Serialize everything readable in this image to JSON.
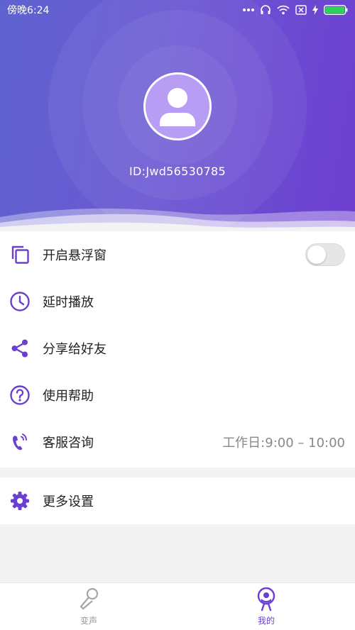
{
  "status_bar": {
    "time": "傍晚6:24"
  },
  "profile": {
    "id_text": "ID:Jwd56530785"
  },
  "menu": {
    "floating_window": "开启悬浮窗",
    "delay_play": "延时播放",
    "share": "分享给好友",
    "help": "使用帮助",
    "customer_service": "客服咨询",
    "work_hours": "工作日:9:00 – 10:00",
    "more_settings": "更多设置"
  },
  "nav": {
    "voice_changer": "变声",
    "mine": "我的"
  },
  "colors": {
    "accent": "#6a3fd2",
    "header_start": "#5f63d0",
    "header_end": "#6d3fd0"
  }
}
